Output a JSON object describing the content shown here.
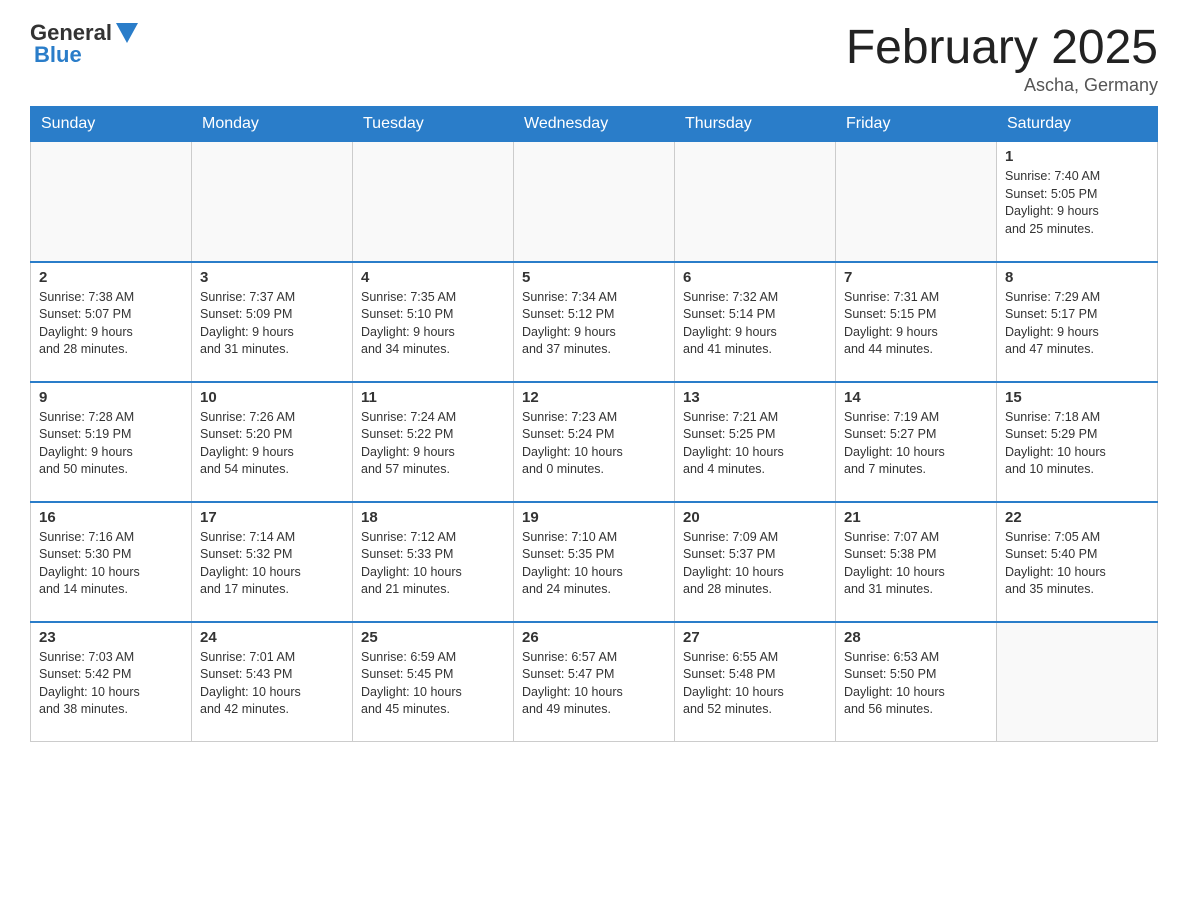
{
  "logo": {
    "text_general": "General",
    "text_blue": "Blue",
    "arrow_char": "▲"
  },
  "title": "February 2025",
  "location": "Ascha, Germany",
  "days_of_week": [
    "Sunday",
    "Monday",
    "Tuesday",
    "Wednesday",
    "Thursday",
    "Friday",
    "Saturday"
  ],
  "weeks": [
    [
      {
        "day": "",
        "info": ""
      },
      {
        "day": "",
        "info": ""
      },
      {
        "day": "",
        "info": ""
      },
      {
        "day": "",
        "info": ""
      },
      {
        "day": "",
        "info": ""
      },
      {
        "day": "",
        "info": ""
      },
      {
        "day": "1",
        "info": "Sunrise: 7:40 AM\nSunset: 5:05 PM\nDaylight: 9 hours\nand 25 minutes."
      }
    ],
    [
      {
        "day": "2",
        "info": "Sunrise: 7:38 AM\nSunset: 5:07 PM\nDaylight: 9 hours\nand 28 minutes."
      },
      {
        "day": "3",
        "info": "Sunrise: 7:37 AM\nSunset: 5:09 PM\nDaylight: 9 hours\nand 31 minutes."
      },
      {
        "day": "4",
        "info": "Sunrise: 7:35 AM\nSunset: 5:10 PM\nDaylight: 9 hours\nand 34 minutes."
      },
      {
        "day": "5",
        "info": "Sunrise: 7:34 AM\nSunset: 5:12 PM\nDaylight: 9 hours\nand 37 minutes."
      },
      {
        "day": "6",
        "info": "Sunrise: 7:32 AM\nSunset: 5:14 PM\nDaylight: 9 hours\nand 41 minutes."
      },
      {
        "day": "7",
        "info": "Sunrise: 7:31 AM\nSunset: 5:15 PM\nDaylight: 9 hours\nand 44 minutes."
      },
      {
        "day": "8",
        "info": "Sunrise: 7:29 AM\nSunset: 5:17 PM\nDaylight: 9 hours\nand 47 minutes."
      }
    ],
    [
      {
        "day": "9",
        "info": "Sunrise: 7:28 AM\nSunset: 5:19 PM\nDaylight: 9 hours\nand 50 minutes."
      },
      {
        "day": "10",
        "info": "Sunrise: 7:26 AM\nSunset: 5:20 PM\nDaylight: 9 hours\nand 54 minutes."
      },
      {
        "day": "11",
        "info": "Sunrise: 7:24 AM\nSunset: 5:22 PM\nDaylight: 9 hours\nand 57 minutes."
      },
      {
        "day": "12",
        "info": "Sunrise: 7:23 AM\nSunset: 5:24 PM\nDaylight: 10 hours\nand 0 minutes."
      },
      {
        "day": "13",
        "info": "Sunrise: 7:21 AM\nSunset: 5:25 PM\nDaylight: 10 hours\nand 4 minutes."
      },
      {
        "day": "14",
        "info": "Sunrise: 7:19 AM\nSunset: 5:27 PM\nDaylight: 10 hours\nand 7 minutes."
      },
      {
        "day": "15",
        "info": "Sunrise: 7:18 AM\nSunset: 5:29 PM\nDaylight: 10 hours\nand 10 minutes."
      }
    ],
    [
      {
        "day": "16",
        "info": "Sunrise: 7:16 AM\nSunset: 5:30 PM\nDaylight: 10 hours\nand 14 minutes."
      },
      {
        "day": "17",
        "info": "Sunrise: 7:14 AM\nSunset: 5:32 PM\nDaylight: 10 hours\nand 17 minutes."
      },
      {
        "day": "18",
        "info": "Sunrise: 7:12 AM\nSunset: 5:33 PM\nDaylight: 10 hours\nand 21 minutes."
      },
      {
        "day": "19",
        "info": "Sunrise: 7:10 AM\nSunset: 5:35 PM\nDaylight: 10 hours\nand 24 minutes."
      },
      {
        "day": "20",
        "info": "Sunrise: 7:09 AM\nSunset: 5:37 PM\nDaylight: 10 hours\nand 28 minutes."
      },
      {
        "day": "21",
        "info": "Sunrise: 7:07 AM\nSunset: 5:38 PM\nDaylight: 10 hours\nand 31 minutes."
      },
      {
        "day": "22",
        "info": "Sunrise: 7:05 AM\nSunset: 5:40 PM\nDaylight: 10 hours\nand 35 minutes."
      }
    ],
    [
      {
        "day": "23",
        "info": "Sunrise: 7:03 AM\nSunset: 5:42 PM\nDaylight: 10 hours\nand 38 minutes."
      },
      {
        "day": "24",
        "info": "Sunrise: 7:01 AM\nSunset: 5:43 PM\nDaylight: 10 hours\nand 42 minutes."
      },
      {
        "day": "25",
        "info": "Sunrise: 6:59 AM\nSunset: 5:45 PM\nDaylight: 10 hours\nand 45 minutes."
      },
      {
        "day": "26",
        "info": "Sunrise: 6:57 AM\nSunset: 5:47 PM\nDaylight: 10 hours\nand 49 minutes."
      },
      {
        "day": "27",
        "info": "Sunrise: 6:55 AM\nSunset: 5:48 PM\nDaylight: 10 hours\nand 52 minutes."
      },
      {
        "day": "28",
        "info": "Sunrise: 6:53 AM\nSunset: 5:50 PM\nDaylight: 10 hours\nand 56 minutes."
      },
      {
        "day": "",
        "info": ""
      }
    ]
  ]
}
